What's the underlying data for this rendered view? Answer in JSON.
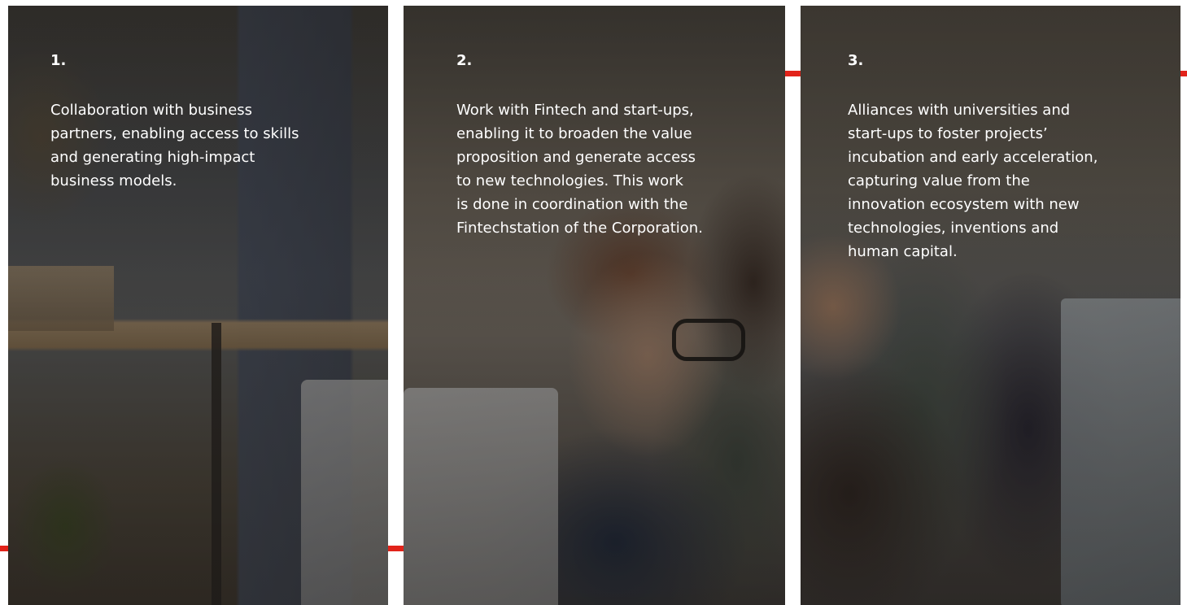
{
  "cards": [
    {
      "number": "1.",
      "text": "Collaboration with business\npartners, enabling access to skills\nand generating high-impact\nbusiness models."
    },
    {
      "number": "2.",
      "text": "Work with Fintech and start-ups,\nenabling it to broaden the value\nproposition and generate access\nto new technologies. This work\nis done in coordination with the\nFintechstation of the Corporation."
    },
    {
      "number": "3.",
      "text": "Alliances with universities and\nstart-ups to foster projects’\nincubation and early acceleration,\ncapturing value from the\ninnovation ecosystem with new\ntechnologies, inventions and\nhuman capital."
    }
  ],
  "colors": {
    "accent": "#e2231a",
    "text": "#ffffff"
  }
}
